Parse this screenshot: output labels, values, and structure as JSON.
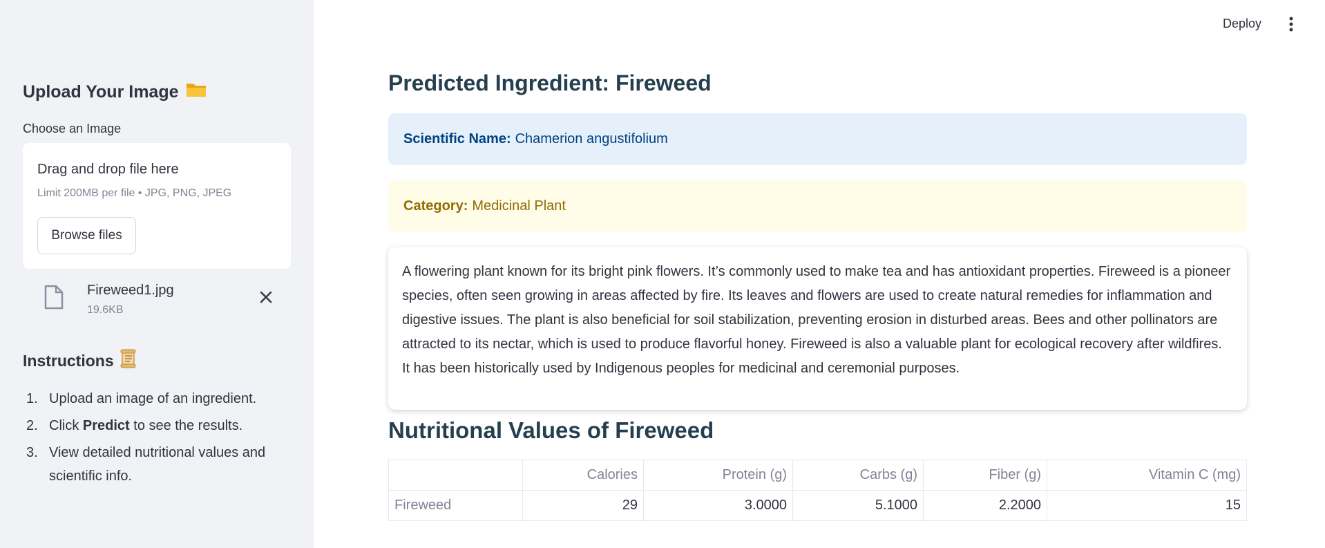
{
  "topbar": {
    "deploy_label": "Deploy",
    "menu_icon": "more-vert-icon"
  },
  "sidebar": {
    "upload_title": "Upload Your Image",
    "upload_title_icon": "folder-icon",
    "uploader_label": "Choose an Image",
    "dropzone_text": "Drag and drop file here",
    "dropzone_limit": "Limit 200MB per file • JPG, PNG, JPEG",
    "browse_label": "Browse files",
    "file": {
      "name": "Fireweed1.jpg",
      "size": "19.6KB"
    },
    "instructions_title": "Instructions",
    "instructions_title_icon": "scroll-icon",
    "instructions": [
      {
        "num": "1.",
        "text": "Upload an image of an ingredient."
      },
      {
        "num": "2.",
        "pre": "Click ",
        "bold": "Predict",
        "post": " to see the results."
      },
      {
        "num": "3.",
        "text": "View detailed nutritional values and scientific info."
      }
    ]
  },
  "main": {
    "predicted_title": "Predicted Ingredient: Fireweed",
    "scientific_label": "Scientific Name:",
    "scientific_value": "Chamerion angustifolium",
    "category_label": "Category:",
    "category_value": "Medicinal Plant",
    "description": "A flowering plant known for its bright pink flowers. It’s commonly used to make tea and has antioxidant properties. Fireweed is a pioneer species, often seen growing in areas affected by fire. Its leaves and flowers are used to create natural remedies for inflammation and digestive issues. The plant is also beneficial for soil stabilization, preventing erosion in disturbed areas. Bees and other pollinators are attracted to its nectar, which is used to produce flavorful honey. Fireweed is also a valuable plant for ecological recovery after wildfires. It has been historically used by Indigenous peoples for medicinal and ceremonial purposes.",
    "nutrition_title": "Nutritional Values of Fireweed",
    "table": {
      "columns": [
        "",
        "Calories",
        "Protein (g)",
        "Carbs (g)",
        "Fiber (g)",
        "Vitamin C (mg)"
      ],
      "rows": [
        [
          "Fireweed",
          "29",
          "3.0000",
          "5.1000",
          "2.2000",
          "15"
        ]
      ]
    }
  }
}
